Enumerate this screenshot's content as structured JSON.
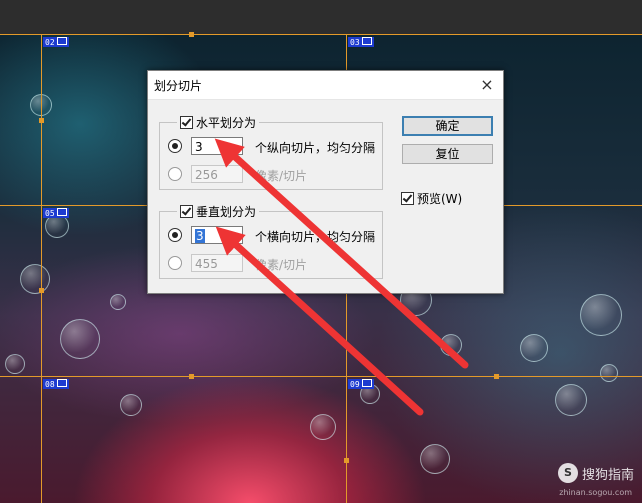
{
  "background": {
    "slice_labels": [
      "02",
      "03",
      "05",
      "08",
      "09"
    ],
    "colors": {
      "slice_line": "#e39a2a",
      "slice_label": "#1d3bd0"
    }
  },
  "dialog": {
    "title": "划分切片",
    "close_symbol": "×",
    "horizontal": {
      "legend": "水平划分为",
      "checked": true,
      "count_value": "3",
      "count_suffix": "个纵向切片，均匀分隔",
      "pixel_value": "256",
      "pixel_suffix": "像素/切片"
    },
    "vertical": {
      "legend": "垂直划分为",
      "checked": true,
      "count_value": "3",
      "count_suffix": "个横向切片，均匀分隔",
      "pixel_value": "455",
      "pixel_suffix": "像素/切片"
    },
    "buttons": {
      "ok": "确定",
      "reset": "复位"
    },
    "preview": {
      "label": "预览(W)",
      "checked": true
    }
  },
  "watermark": {
    "text": "搜狗指南",
    "url": "zhinan.sogou.com",
    "icon": "S"
  },
  "colors": {
    "annotation_arrow": "#ee3434",
    "default_button_border": "#3c7fb1"
  }
}
